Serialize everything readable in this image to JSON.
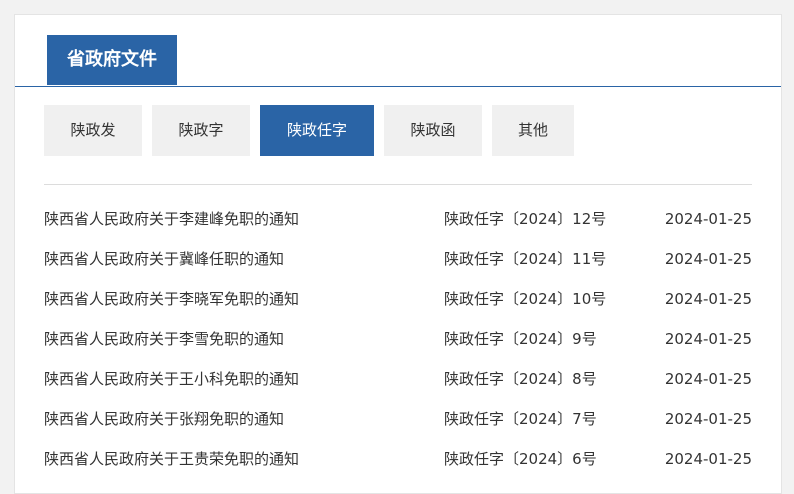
{
  "panel": {
    "title": "省政府文件"
  },
  "tabs": [
    {
      "label": "陕政发",
      "active": false
    },
    {
      "label": "陕政字",
      "active": false
    },
    {
      "label": "陕政任字",
      "active": true
    },
    {
      "label": "陕政函",
      "active": false
    },
    {
      "label": "其他",
      "active": false
    }
  ],
  "documents": [
    {
      "title": "陕西省人民政府关于李建峰免职的通知",
      "number": "陕政任字〔2024〕12号",
      "date": "2024-01-25"
    },
    {
      "title": "陕西省人民政府关于冀峰任职的通知",
      "number": "陕政任字〔2024〕11号",
      "date": "2024-01-25"
    },
    {
      "title": "陕西省人民政府关于李晓军免职的通知",
      "number": "陕政任字〔2024〕10号",
      "date": "2024-01-25"
    },
    {
      "title": "陕西省人民政府关于李雪免职的通知",
      "number": "陕政任字〔2024〕9号",
      "date": "2024-01-25"
    },
    {
      "title": "陕西省人民政府关于王小科免职的通知",
      "number": "陕政任字〔2024〕8号",
      "date": "2024-01-25"
    },
    {
      "title": "陕西省人民政府关于张翔免职的通知",
      "number": "陕政任字〔2024〕7号",
      "date": "2024-01-25"
    },
    {
      "title": "陕西省人民政府关于王贵荣免职的通知",
      "number": "陕政任字〔2024〕6号",
      "date": "2024-01-25"
    }
  ],
  "colors": {
    "accent": "#2a64a6",
    "tab_background": "#f0f0f0"
  }
}
